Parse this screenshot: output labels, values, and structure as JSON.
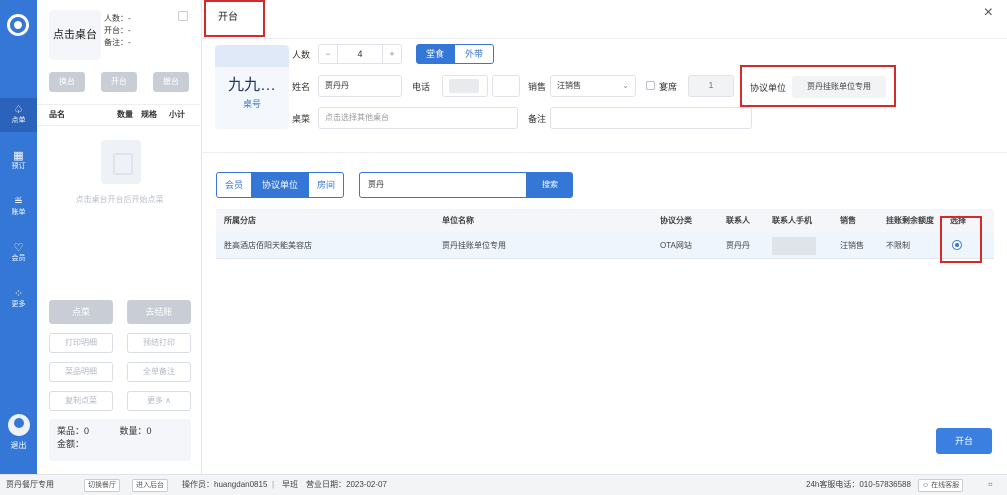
{
  "rail": {
    "items": [
      {
        "label": "点单",
        "icon": "dish-icon",
        "glyph": "♤"
      },
      {
        "label": "预订",
        "icon": "calendar-icon",
        "glyph": "▦"
      },
      {
        "label": "账单",
        "icon": "bill-icon",
        "glyph": "≝"
      },
      {
        "label": "会员",
        "icon": "member-icon",
        "glyph": "♡"
      },
      {
        "label": "更多",
        "icon": "more-icon",
        "glyph": "⁘"
      }
    ],
    "logout": "退出"
  },
  "left_panel": {
    "table_name": "点击桌台",
    "info": [
      "人数：-",
      "开台：-",
      "备注：-"
    ],
    "buttons": [
      "换台",
      "开台",
      "撤台"
    ],
    "columns": [
      "品名",
      "数量",
      "规格",
      "小计"
    ],
    "empty_text": "点击桌台开台后开始点菜",
    "big_buttons": [
      "点菜",
      "去结账"
    ],
    "small_buttons": [
      "打印明细",
      "预结打印",
      "菜品明细",
      "全单备注",
      "复制点菜",
      "更多 ∧"
    ],
    "summary": {
      "items": "菜品：0",
      "qty": "数量：0",
      "amount": "金额："
    }
  },
  "dialog": {
    "title": "开台",
    "table_card": {
      "name": "九九…",
      "label": "桌号"
    },
    "form": {
      "people_label": "人数",
      "people_minus": "−",
      "people_value": "4",
      "people_plus": "+",
      "mode_options": [
        "堂食",
        "外带"
      ],
      "name_label": "姓名",
      "name_value": "贾丹丹",
      "phone_label": "电话",
      "sales_label": "销售",
      "sales_value": "汪销售",
      "banquet_label": "宴席",
      "banquet_value": "1",
      "agreement_label": "协议单位",
      "agreement_value": "贾丹挂账单位专用",
      "dish_label": "桌菜",
      "dish_placeholder": "点击选择其他桌台",
      "remark_label": "备注"
    },
    "tabs": [
      "会员",
      "协议单位",
      "房间"
    ],
    "search_value": "贾丹",
    "search_button": "搜索",
    "table": {
      "headers": [
        "所属分店",
        "单位名称",
        "协议分类",
        "联系人",
        "联系人手机",
        "销售",
        "挂账剩余额度",
        "选择"
      ],
      "rows": [
        {
          "branch": "胜高酒店佰阳天能美容店",
          "unit": "贾丹挂账单位专用",
          "category": "OTA网站",
          "contact": "贾丹丹",
          "sales": "汪销售",
          "limit": "不限制"
        }
      ]
    },
    "submit": "开台",
    "close": "×"
  },
  "status_bar": {
    "store": "贾丹餐厅专用",
    "switch": "切换餐厅",
    "backend": "进入后台",
    "operator": "操作员：huangdan0815",
    "shift": "早班",
    "business_date": "营业日期：2023-02-07",
    "hotline": "24h客服电话：010-57836588",
    "online": "在线客服"
  },
  "colors": {
    "primary": "#3577d6",
    "highlight": "#d42a2a"
  }
}
